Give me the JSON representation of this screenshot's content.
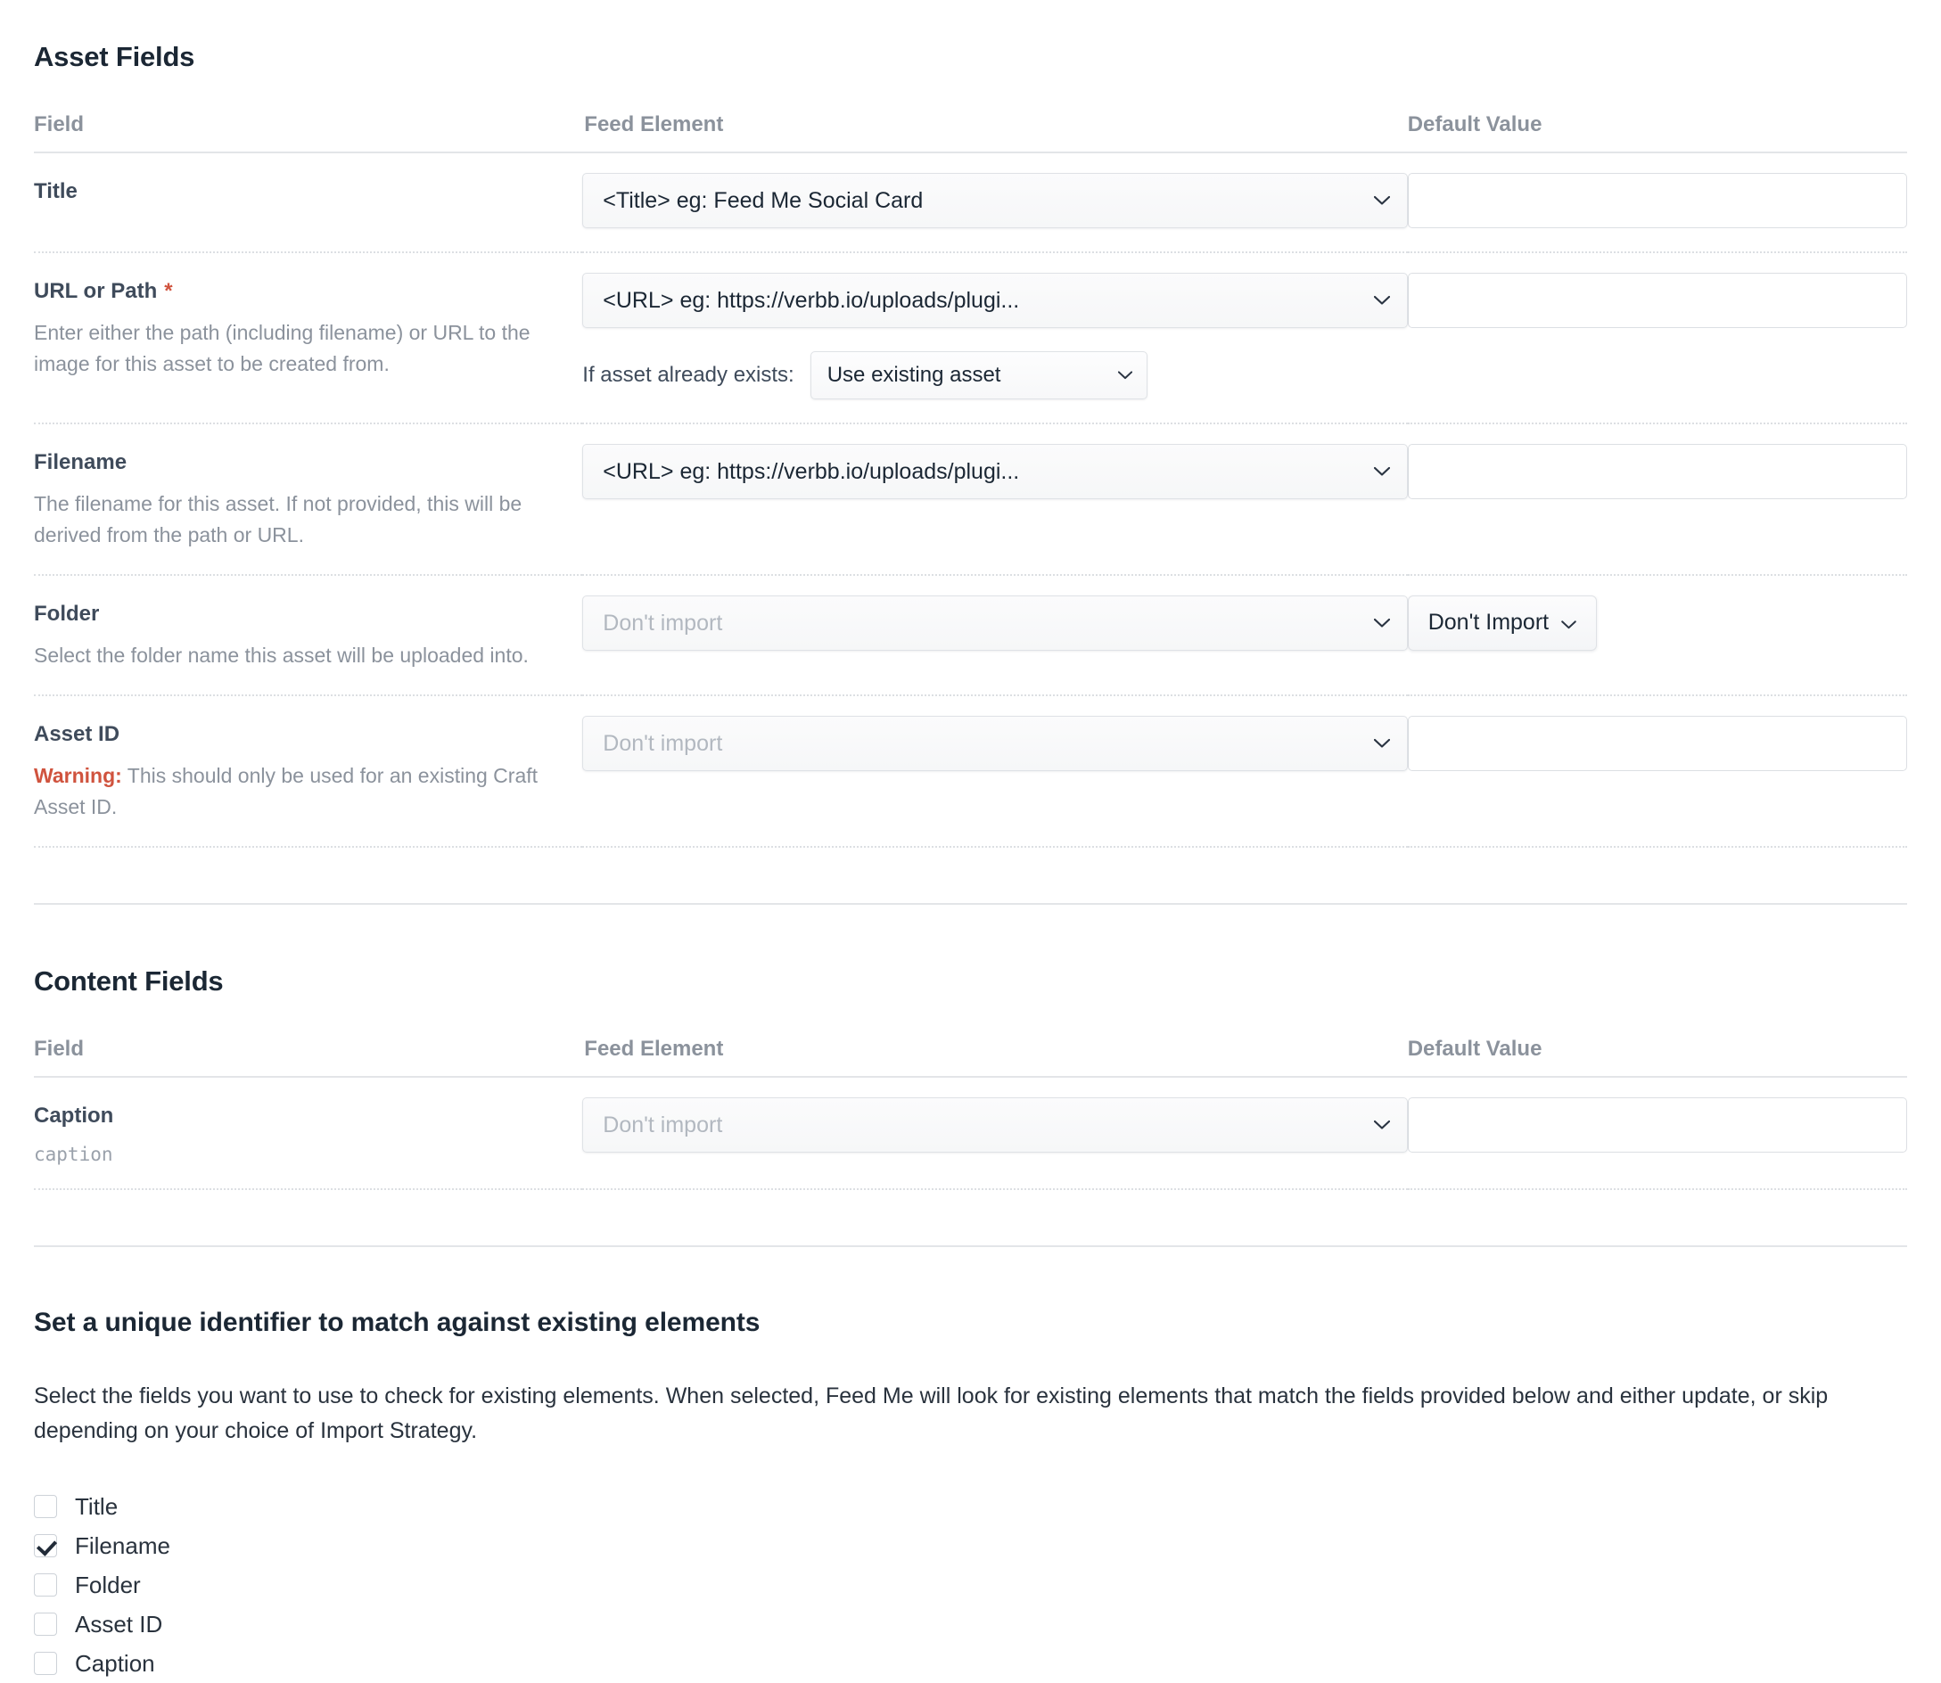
{
  "asset_section": {
    "title": "Asset Fields",
    "headers": {
      "field": "Field",
      "feed_element": "Feed Element",
      "default_value": "Default Value"
    },
    "rows": [
      {
        "label": "Title",
        "required": false,
        "instructions": "",
        "feed_value": "<Title> eg: Feed Me Social Card",
        "feed_placeholder": false,
        "default_value": "",
        "has_default_input": true
      },
      {
        "label": "URL or Path",
        "required": true,
        "required_marker": "*",
        "instructions": "Enter either the path (including filename) or URL to the image for this asset to be created from.",
        "feed_value": "<URL> eg: https://verbb.io/uploads/plugi...",
        "feed_placeholder": false,
        "default_value": "",
        "has_default_input": true,
        "sub_row": {
          "label": "If asset already exists:",
          "value": "Use existing asset"
        }
      },
      {
        "label": "Filename",
        "required": false,
        "instructions": "The filename for this asset. If not provided, this will be derived from the path or URL.",
        "feed_value": "<URL> eg: https://verbb.io/uploads/plugi...",
        "feed_placeholder": false,
        "default_value": "",
        "has_default_input": true
      },
      {
        "label": "Folder",
        "required": false,
        "instructions": "Select the folder name this asset will be uploaded into.",
        "feed_value": "Don't import",
        "feed_placeholder": true,
        "has_default_input": false,
        "default_button": "Don't Import"
      },
      {
        "label": "Asset ID",
        "required": false,
        "warning_prefix": "Warning:",
        "instructions": " This should only be used for an existing Craft Asset ID.",
        "feed_value": "Don't import",
        "feed_placeholder": true,
        "default_value": "",
        "has_default_input": true
      }
    ]
  },
  "content_section": {
    "title": "Content Fields",
    "headers": {
      "field": "Field",
      "feed_element": "Feed Element",
      "default_value": "Default Value"
    },
    "rows": [
      {
        "label": "Caption",
        "handle": "caption",
        "feed_value": "Don't import",
        "feed_placeholder": true,
        "default_value": "",
        "has_default_input": true
      }
    ]
  },
  "unique_identifier": {
    "title": "Set a unique identifier to match against existing elements",
    "description": "Select the fields you want to use to check for existing elements. When selected, Feed Me will look for existing elements that match the fields provided below and either update, or skip depending on your choice of Import Strategy.",
    "options": [
      {
        "label": "Title",
        "checked": false
      },
      {
        "label": "Filename",
        "checked": true
      },
      {
        "label": "Folder",
        "checked": false
      },
      {
        "label": "Asset ID",
        "checked": false
      },
      {
        "label": "Caption",
        "checked": false
      }
    ]
  },
  "colors": {
    "accent_warning": "#d0533e",
    "heading": "#1b2734",
    "muted": "#8b929c",
    "border": "#dfe2e6"
  }
}
